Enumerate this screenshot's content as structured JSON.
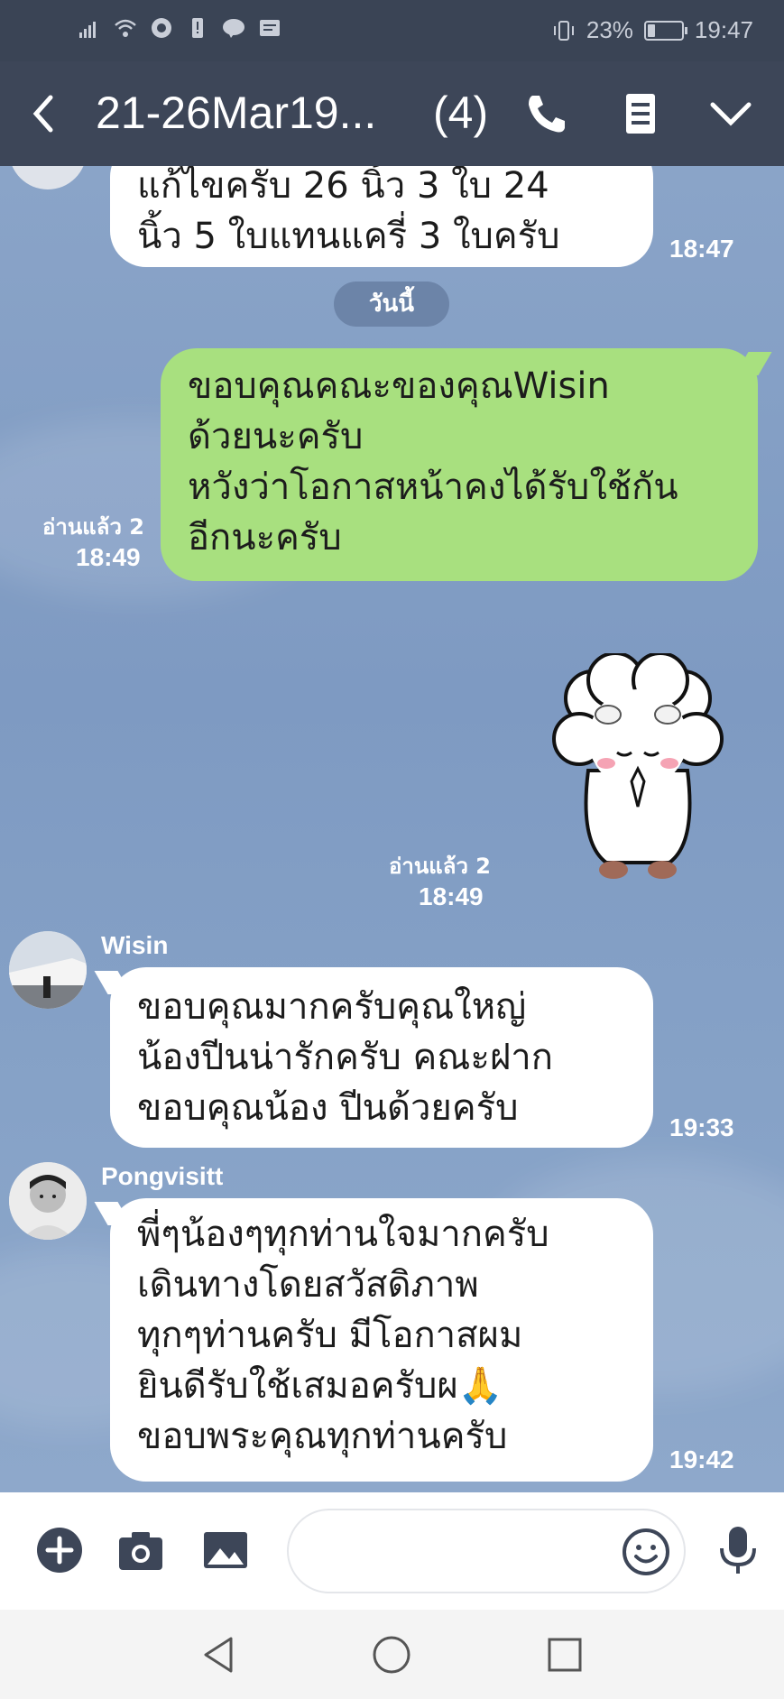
{
  "status_bar": {
    "battery": "23%",
    "battery_level": 0.23,
    "time": "19:47"
  },
  "header": {
    "title": "21-26Mar19...",
    "member_count": "(4)"
  },
  "chat": {
    "partial_message": {
      "lines": [
        "แก้ไขครับ 26 นิ้ว 3 ใบ 24",
        "นิ้ว 5 ใบแทนแครี่ 3 ใบครับ"
      ],
      "time": "18:47"
    },
    "date_separator": "วันนี้",
    "my_message": {
      "lines": [
        "ขอบคุณคณะของคุณWisin",
        "ด้วยนะครับ",
        "หวังว่าโอกาสหน้าคงได้รับใช้กัน",
        "อีกนะครับ"
      ],
      "read": "อ่านแล้ว 2",
      "time": "18:49"
    },
    "my_sticker": {
      "read": "อ่านแล้ว 2",
      "time": "18:49"
    },
    "msg_wisin": {
      "sender": "Wisin",
      "lines": [
        "ขอบคุณมากครับคุณใหญ่",
        "น้องปีนน่ารักครับ คณะฝาก",
        "ขอบคุณน้อง ปีนด้วยครับ"
      ],
      "time": "19:33"
    },
    "msg_pong": {
      "sender": "Pongvisitt",
      "lines": [
        "พี่ๆน้องๆทุกท่านใจมากครับ",
        "เดินทางโดยสวัสดิภาพ",
        "ทุกๆท่านครับ มีโอกาสผม",
        "ยินดีรับใช้เสมอครับผ🙏",
        "ขอบพระคุณทุกท่านครับ"
      ],
      "time": "19:42"
    }
  },
  "input": {
    "placeholder": ""
  },
  "icons": {
    "back": "chevron-left-icon",
    "call": "phone-icon",
    "notes": "notes-icon",
    "menu": "chevron-down-icon",
    "add": "plus-circle-icon",
    "camera": "camera-icon",
    "image": "image-icon",
    "emoji": "emoji-icon",
    "mic": "microphone-icon"
  },
  "colors": {
    "header": "#3d4658",
    "chat_background": "#7f9cc4",
    "my_bubble": "#a8e07f",
    "their_bubble": "#ffffff"
  }
}
